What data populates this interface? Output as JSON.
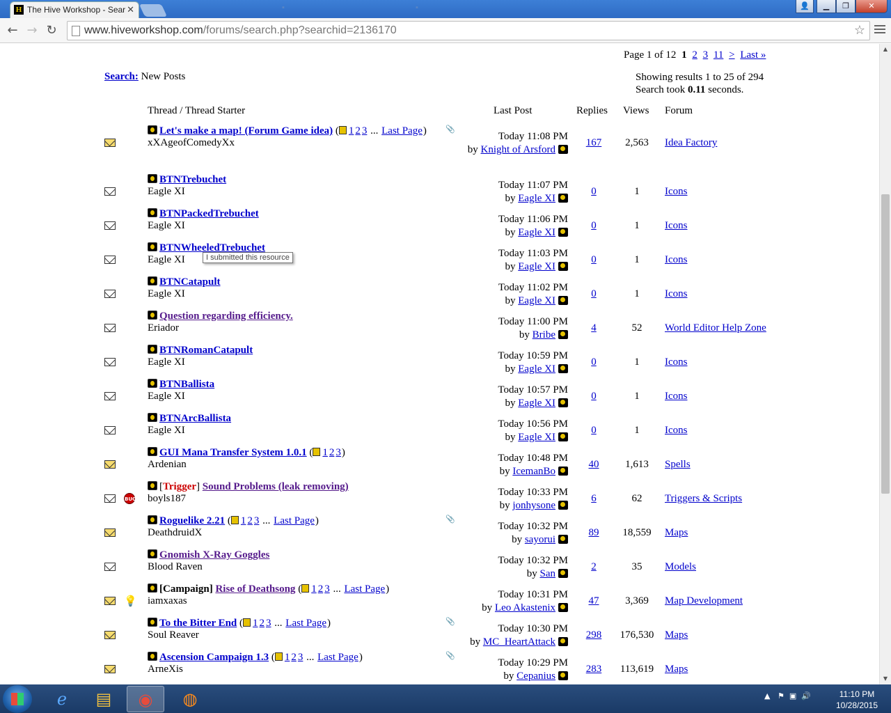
{
  "browser": {
    "active_tab_title": "The Hive Workshop - Sear",
    "url_host": "www.hiveworkshop.com",
    "url_path": "/forums/search.php?searchid=2136170"
  },
  "page": {
    "pagenav": {
      "label": "Page 1 of 12",
      "current": "1",
      "links": [
        "2",
        "3",
        "11",
        ">",
        "Last »"
      ]
    },
    "search_label": "Search:",
    "search_subtitle": "New Posts",
    "results_line1": "Showing results 1 to 25 of 294",
    "results_line2_prefix": "Search took",
    "results_line2_time": "0.11",
    "results_line2_suffix": "seconds.",
    "columns": {
      "thread": "Thread / Thread Starter",
      "last_post": "Last Post",
      "replies": "Replies",
      "views": "Views",
      "forum": "Forum"
    },
    "tooltip": "I submitted this resource",
    "threads": [
      {
        "title": "Let's make a map! (Forum Game idea)",
        "pages": [
          "1",
          "2",
          "3"
        ],
        "last_page": "Last Page",
        "starter": "xXAgeofComedyXx",
        "date": "Today 11:08 PM",
        "by": "Knight of Arsford",
        "replies": "167",
        "views": "2,563",
        "forum": "Idea Factory",
        "hot": true,
        "clip": true
      },
      {
        "title": "BTNTrebuchet",
        "starter": "Eagle XI",
        "date": "Today 11:07 PM",
        "by": "Eagle XI",
        "replies": "0",
        "views": "1",
        "forum": "Icons"
      },
      {
        "title": "BTNPackedTrebuchet",
        "starter": "Eagle XI",
        "date": "Today 11:06 PM",
        "by": "Eagle XI",
        "replies": "0",
        "views": "1",
        "forum": "Icons"
      },
      {
        "title": "BTNWheeledTrebuchet",
        "starter": "Eagle XI",
        "date": "Today 11:03 PM",
        "by": "Eagle XI",
        "replies": "0",
        "views": "1",
        "forum": "Icons"
      },
      {
        "title": "BTNCatapult",
        "starter": "Eagle XI",
        "date": "Today 11:02 PM",
        "by": "Eagle XI",
        "replies": "0",
        "views": "1",
        "forum": "Icons"
      },
      {
        "title": "Question regarding efficiency.",
        "starter": "Eriador",
        "date": "Today 11:00 PM",
        "by": "Bribe",
        "replies": "4",
        "views": "52",
        "forum": "World Editor Help Zone",
        "visited": true
      },
      {
        "title": "BTNRomanCatapult",
        "starter": "Eagle XI",
        "date": "Today 10:59 PM",
        "by": "Eagle XI",
        "replies": "0",
        "views": "1",
        "forum": "Icons"
      },
      {
        "title": "BTNBallista",
        "starter": "Eagle XI",
        "date": "Today 10:57 PM",
        "by": "Eagle XI",
        "replies": "0",
        "views": "1",
        "forum": "Icons"
      },
      {
        "title": "BTNArcBallista",
        "starter": "Eagle XI",
        "date": "Today 10:56 PM",
        "by": "Eagle XI",
        "replies": "0",
        "views": "1",
        "forum": "Icons"
      },
      {
        "title": "GUI Mana Transfer System 1.0.1",
        "pages": [
          "1",
          "2",
          "3"
        ],
        "starter": "Ardenian",
        "date": "Today 10:48 PM",
        "by": "IcemanBo",
        "replies": "40",
        "views": "1,613",
        "forum": "Spells",
        "hot": true
      },
      {
        "prefix": "Trigger",
        "prefix_style": "red",
        "title": "Sound Problems (leak removing)",
        "starter": "boyls187",
        "date": "Today 10:33 PM",
        "by": "jonhysone",
        "replies": "6",
        "views": "62",
        "forum": "Triggers & Scripts",
        "icon": "bug",
        "visited": true
      },
      {
        "title": "Roguelike 2.21",
        "pages": [
          "1",
          "2",
          "3"
        ],
        "last_page": "Last Page",
        "starter": "DeathdruidX",
        "date": "Today 10:32 PM",
        "by": "sayorui",
        "replies": "89",
        "views": "18,559",
        "forum": "Maps",
        "hot": true,
        "clip": true
      },
      {
        "title": "Gnomish X-Ray Goggles",
        "starter": "Blood Raven",
        "date": "Today 10:32 PM",
        "by": "San",
        "replies": "2",
        "views": "35",
        "forum": "Models",
        "visited": true
      },
      {
        "prefix": "Campaign",
        "prefix_style": "bold",
        "title": "Rise of Deathsong",
        "pages": [
          "1",
          "2",
          "3"
        ],
        "last_page": "Last Page",
        "starter": "iamxaxas",
        "date": "Today 10:31 PM",
        "by": "Leo Akastenix",
        "replies": "47",
        "views": "3,369",
        "forum": "Map Development",
        "icon": "bulb",
        "hot": true,
        "visited": true
      },
      {
        "title": "To the Bitter End",
        "pages": [
          "1",
          "2",
          "3"
        ],
        "last_page": "Last Page",
        "starter": "Soul Reaver",
        "date": "Today 10:30 PM",
        "by": "MC_HeartAttack",
        "replies": "298",
        "views": "176,530",
        "forum": "Maps",
        "hot": true,
        "clip": true
      },
      {
        "title": "Ascension Campaign 1.3",
        "pages": [
          "1",
          "2",
          "3"
        ],
        "last_page": "Last Page",
        "starter": "ArneXis",
        "date": "Today 10:29 PM",
        "by": "Cepanius",
        "replies": "283",
        "views": "113,619",
        "forum": "Maps",
        "hot": true,
        "clip": true
      }
    ]
  },
  "taskbar": {
    "time": "11:10 PM",
    "date": "10/28/2015"
  }
}
